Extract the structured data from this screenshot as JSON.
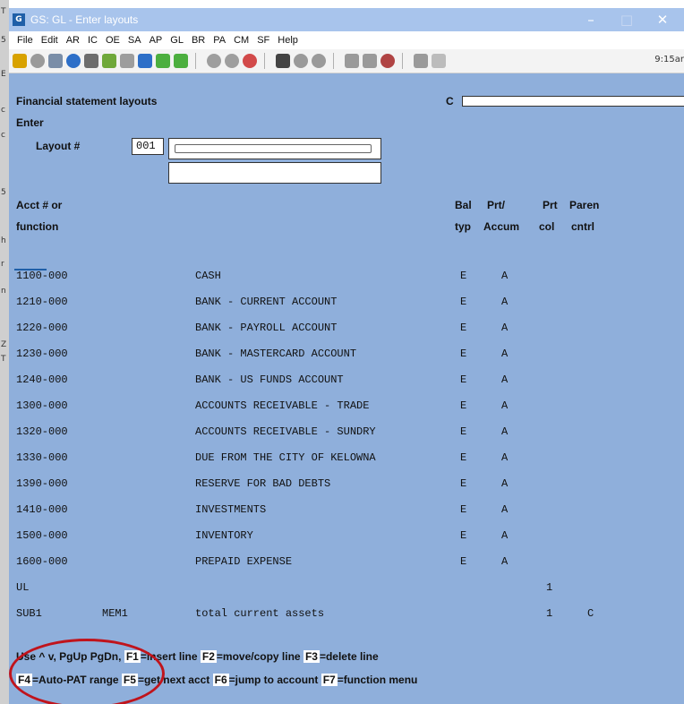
{
  "window": {
    "title": "GS: GL - Enter layouts",
    "controls": [
      "–",
      "□",
      "✕"
    ]
  },
  "menu": [
    "File",
    "Edit",
    "AR",
    "IC",
    "OE",
    "SA",
    "AP",
    "GL",
    "BR",
    "PA",
    "CM",
    "SF",
    "Help"
  ],
  "toolbar": {
    "clock": "9:15ar"
  },
  "header": {
    "title": "Financial statement layouts",
    "mode": "Enter",
    "company_prefix": "C",
    "layout_label": "Layout #",
    "layout_value": "001"
  },
  "columns": {
    "acct_1": "Acct # or",
    "acct_2": "function",
    "bal_1": "Bal",
    "bal_2": "typ",
    "prt_1": "Prt/",
    "prt_2": "Accum",
    "col_1": "Prt",
    "col_2": "col",
    "paren_1": "Paren",
    "paren_2": "cntrl"
  },
  "rows": [
    {
      "acct": "1100-000",
      "desc": "CASH",
      "bal": "E",
      "prt": "A",
      "col": "",
      "paren": ""
    },
    {
      "acct": "1210-000",
      "desc": "BANK - CURRENT ACCOUNT",
      "bal": "E",
      "prt": "A",
      "col": "",
      "paren": ""
    },
    {
      "acct": "1220-000",
      "desc": "BANK - PAYROLL ACCOUNT",
      "bal": "E",
      "prt": "A",
      "col": "",
      "paren": ""
    },
    {
      "acct": "1230-000",
      "desc": "BANK - MASTERCARD ACCOUNT",
      "bal": "E",
      "prt": "A",
      "col": "",
      "paren": ""
    },
    {
      "acct": "1240-000",
      "desc": "BANK - US FUNDS ACCOUNT",
      "bal": "E",
      "prt": "A",
      "col": "",
      "paren": ""
    },
    {
      "acct": "1300-000",
      "desc": "ACCOUNTS RECEIVABLE - TRADE",
      "bal": "E",
      "prt": "A",
      "col": "",
      "paren": ""
    },
    {
      "acct": "1320-000",
      "desc": "ACCOUNTS RECEIVABLE - SUNDRY",
      "bal": "E",
      "prt": "A",
      "col": "",
      "paren": ""
    },
    {
      "acct": "1330-000",
      "desc": "DUE FROM THE CITY OF KELOWNA",
      "bal": "E",
      "prt": "A",
      "col": "",
      "paren": ""
    },
    {
      "acct": "1390-000",
      "desc": "RESERVE FOR BAD DEBTS",
      "bal": "E",
      "prt": "A",
      "col": "",
      "paren": ""
    },
    {
      "acct": "1410-000",
      "desc": "INVESTMENTS",
      "bal": "E",
      "prt": "A",
      "col": "",
      "paren": ""
    },
    {
      "acct": "1500-000",
      "desc": "INVENTORY",
      "bal": "E",
      "prt": "A",
      "col": "",
      "paren": ""
    },
    {
      "acct": "1600-000",
      "desc": "PREPAID EXPENSE",
      "bal": "E",
      "prt": "A",
      "col": "",
      "paren": ""
    },
    {
      "acct": "UL",
      "desc": "",
      "bal": "",
      "prt": "",
      "col": "1",
      "paren": ""
    },
    {
      "acct": "SUB1",
      "mem": "MEM1",
      "desc": "total current assets",
      "bal": "",
      "prt": "",
      "col": "1",
      "paren": "C"
    }
  ],
  "help": {
    "line1_prefix": "Use ^ v, PgUp PgDn,",
    "f1_key": "F1",
    "f1_text": "=insert line",
    "f2_key": "F2",
    "f2_text": "=move/copy line",
    "f3_key": "F3",
    "f3_text": "=delete line",
    "f4_key": "F4",
    "f4_text": "=Auto-PAT range",
    "f5_key": "F5",
    "f5_text": "=get next acct",
    "f6_key": "F6",
    "f6_text": "=jump to account",
    "f7_key": "F7",
    "f7_text": "=function menu"
  },
  "colors": {
    "window_bg": "#8fafdb",
    "annotation": "#c0141c"
  }
}
